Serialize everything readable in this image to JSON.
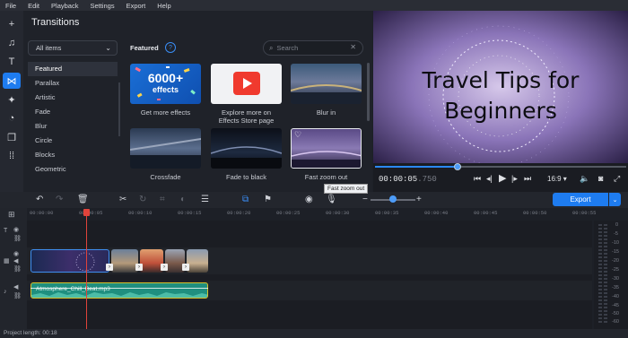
{
  "menu": [
    "File",
    "Edit",
    "Playback",
    "Settings",
    "Export",
    "Help"
  ],
  "panel": {
    "title": "Transitions",
    "dropdown": "All items",
    "categories": [
      "Featured",
      "Parallax",
      "Artistic",
      "Fade",
      "Blur",
      "Circle",
      "Blocks",
      "Geometric"
    ],
    "selected_category": "Featured",
    "featured_heading": "Featured",
    "search_placeholder": "Search"
  },
  "tiles": [
    {
      "label": "Get more effects",
      "badge_big": "6000+",
      "badge_small": "effects"
    },
    {
      "label": "Explore more on Effects Store page"
    },
    {
      "label": "Blur in"
    },
    {
      "label": "Crossfade"
    },
    {
      "label": "Fade to black"
    },
    {
      "label": "Fast zoom out"
    }
  ],
  "tooltip": "Fast zoom out",
  "preview": {
    "title_line1": "Travel Tips for",
    "title_line2": "Beginners",
    "progress": 0.33,
    "timecode_main": "00:00:05",
    "timecode_frac": ".750",
    "ratio": "16:9 ▾"
  },
  "toolbar": {
    "export_label": "Export",
    "zoom_level": 0.5
  },
  "ruler_ticks": [
    "00:00:00",
    "00:00:05",
    "00:00:10",
    "00:00:15",
    "00:00:20",
    "00:00:25",
    "00:00:30",
    "00:00:35",
    "00:00:40",
    "00:00:45",
    "00:00:50",
    "00:00:55"
  ],
  "audio_clip": "Atmosphere_Chill_Beat.mp3",
  "meter_db": [
    "0",
    "-5",
    "-10",
    "-15",
    "-20",
    "-25",
    "-30",
    "-35",
    "-40",
    "-45",
    "-50",
    "-60"
  ],
  "status": "Project length: 00:18",
  "colors": {
    "accent": "#1e7cf0",
    "playhead": "#e0433b",
    "audio": "#1f8f7f"
  }
}
